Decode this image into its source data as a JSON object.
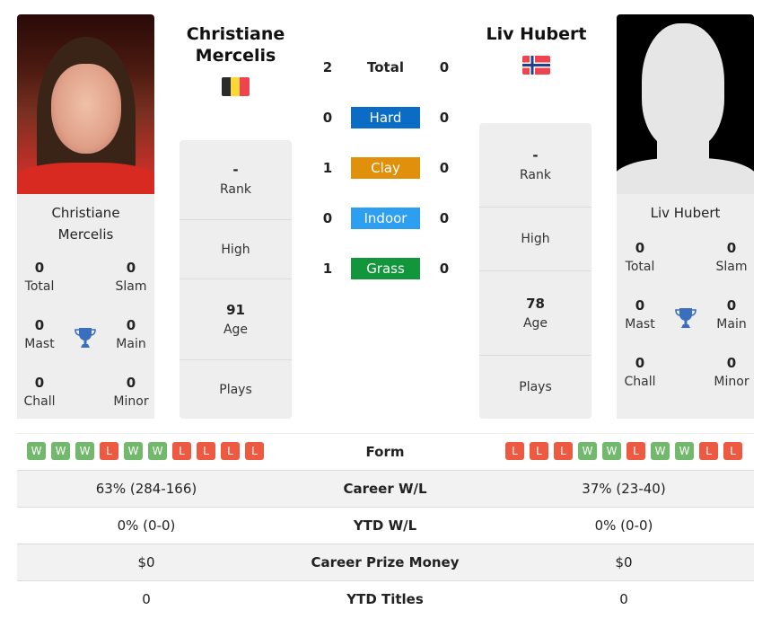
{
  "player1": {
    "name": "Christiane Mercelis",
    "name_line1": "Christiane",
    "name_line2": "Mercelis",
    "flag": "belgium-flag",
    "flag_colors": [
      "#2b2b2b",
      "#fdd835",
      "#ef4450"
    ],
    "rank": "-",
    "rank_label": "Rank",
    "high_label": "High",
    "age": "91",
    "age_label": "Age",
    "plays_label": "Plays",
    "titles": {
      "total": "0",
      "total_label": "Total",
      "slam": "0",
      "slam_label": "Slam",
      "mast": "0",
      "mast_label": "Mast",
      "main": "0",
      "main_label": "Main",
      "chall": "0",
      "chall_label": "Chall",
      "minor": "0",
      "minor_label": "Minor"
    },
    "form": [
      "W",
      "W",
      "W",
      "L",
      "W",
      "W",
      "L",
      "L",
      "L",
      "L"
    ],
    "career_wl": "63% (284-166)",
    "ytd_wl": "0% (0-0)",
    "prize_money": "$0",
    "ytd_titles": "0"
  },
  "player2": {
    "name": "Liv Hubert",
    "flag": "norway-flag",
    "flag_colors": [
      "#ef4450",
      "#ffffff",
      "#1f3f8f"
    ],
    "rank": "-",
    "rank_label": "Rank",
    "high_label": "High",
    "age": "78",
    "age_label": "Age",
    "plays_label": "Plays",
    "titles": {
      "total": "0",
      "total_label": "Total",
      "slam": "0",
      "slam_label": "Slam",
      "mast": "0",
      "mast_label": "Mast",
      "main": "0",
      "main_label": "Main",
      "chall": "0",
      "chall_label": "Chall",
      "minor": "0",
      "minor_label": "Minor"
    },
    "form": [
      "L",
      "L",
      "L",
      "W",
      "W",
      "L",
      "W",
      "W",
      "L",
      "L"
    ],
    "career_wl": "37% (23-40)",
    "ytd_wl": "0% (0-0)",
    "prize_money": "$0",
    "ytd_titles": "0"
  },
  "h2h": [
    {
      "label": "Total",
      "p1": "2",
      "p2": "0",
      "color": ""
    },
    {
      "label": "Hard",
      "p1": "0",
      "p2": "0",
      "color": "#0a6cc4"
    },
    {
      "label": "Clay",
      "p1": "1",
      "p2": "0",
      "color": "#e0900a"
    },
    {
      "label": "Indoor",
      "p1": "0",
      "p2": "0",
      "color": "#2d9ff0"
    },
    {
      "label": "Grass",
      "p1": "1",
      "p2": "0",
      "color": "#11963c"
    }
  ],
  "stats": {
    "form_label": "Form",
    "career_wl_label": "Career W/L",
    "ytd_wl_label": "YTD W/L",
    "prize_label": "Career Prize Money",
    "ytd_titles_label": "YTD Titles"
  },
  "colors": {
    "win": "#72b96e",
    "loss": "#ed5a41",
    "trophy": "#3a6fbd"
  }
}
